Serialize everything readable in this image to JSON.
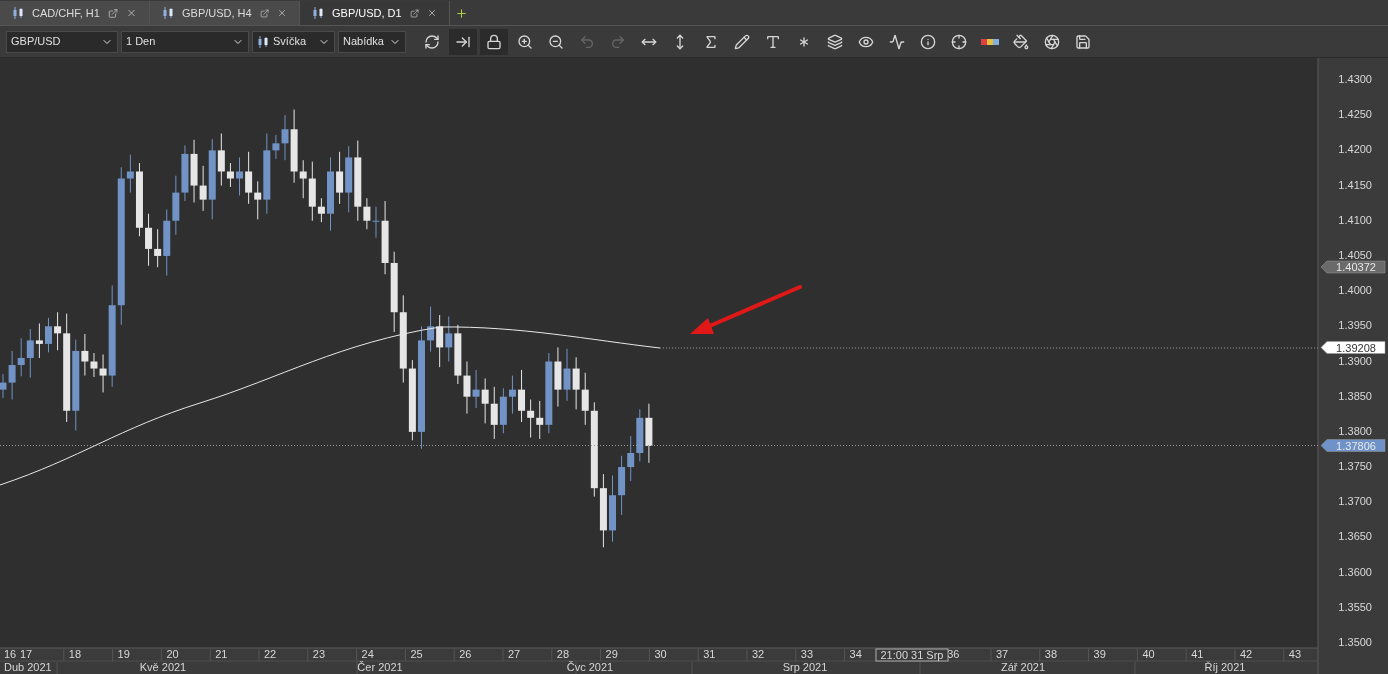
{
  "tabs": [
    {
      "label": "CAD/CHF, H1",
      "selected": false
    },
    {
      "label": "GBP/USD, H4",
      "selected": false
    },
    {
      "label": "GBP/USD, D1",
      "selected": true
    }
  ],
  "toolbar": {
    "dropdowns": [
      {
        "value": "GBP/USD"
      },
      {
        "value": "1 Den"
      },
      {
        "value": "Svíčka",
        "kind": "candle"
      },
      {
        "value": "Nabídka"
      }
    ],
    "icon_buttons": [
      {
        "kind": "refresh",
        "pressed": false,
        "disabled": false
      },
      {
        "kind": "shift",
        "pressed": true,
        "disabled": false
      },
      {
        "kind": "lock",
        "pressed": true,
        "disabled": false
      },
      {
        "kind": "zoom-in",
        "pressed": false,
        "disabled": false
      },
      {
        "kind": "zoom-out",
        "pressed": false,
        "disabled": false
      },
      {
        "kind": "undo",
        "pressed": false,
        "disabled": true
      },
      {
        "kind": "redo",
        "pressed": false,
        "disabled": true
      },
      {
        "kind": "horizontal",
        "pressed": false,
        "disabled": false
      },
      {
        "kind": "vertical",
        "pressed": false,
        "disabled": false
      },
      {
        "kind": "function",
        "pressed": false,
        "disabled": false
      },
      {
        "kind": "pencil",
        "pressed": false,
        "disabled": false
      },
      {
        "kind": "text",
        "pressed": false,
        "disabled": false
      },
      {
        "kind": "nodes",
        "pressed": false,
        "disabled": false
      },
      {
        "kind": "layers",
        "pressed": false,
        "disabled": false
      },
      {
        "kind": "eye",
        "pressed": false,
        "disabled": false
      },
      {
        "kind": "wave",
        "pressed": false,
        "disabled": false
      },
      {
        "kind": "info",
        "pressed": false,
        "disabled": false
      },
      {
        "kind": "crosshair",
        "pressed": false,
        "disabled": false
      },
      {
        "kind": "colors",
        "pressed": false,
        "disabled": false
      },
      {
        "kind": "bucket",
        "pressed": false,
        "disabled": false
      },
      {
        "kind": "aperture",
        "pressed": false,
        "disabled": false
      },
      {
        "kind": "save",
        "pressed": false,
        "disabled": false
      }
    ]
  },
  "price_axis": {
    "labels": [
      "1.4300",
      "1.4250",
      "1.4200",
      "1.4150",
      "1.4100",
      "1.4050",
      "1.4000",
      "1.3950",
      "1.3900",
      "1.3850",
      "1.3800",
      "1.3750",
      "1.3700",
      "1.3650",
      "1.3600",
      "1.3550",
      "1.3500"
    ],
    "tags": [
      {
        "label": "1.40372",
        "color": "#6a6a6a"
      },
      {
        "label": "1.39208",
        "color": "#ffffff"
      },
      {
        "label": "1.37806",
        "color": "#6f93c8"
      }
    ]
  },
  "time_axis": {
    "weeks": [
      "16",
      "17",
      "18",
      "19",
      "20",
      "21",
      "22",
      "23",
      "24",
      "25",
      "26",
      "27",
      "28",
      "29",
      "30",
      "31",
      "32",
      "33",
      "34",
      "36",
      "37",
      "38",
      "39",
      "40",
      "41",
      "42",
      "43"
    ],
    "crosshair_label": "21:00 31 Srp",
    "months": [
      "Dub 2021",
      "Kvě 2021",
      "Čer 2021",
      "Čvc 2021",
      "Srp 2021",
      "Zář 2021",
      "Říj 2021"
    ]
  }
}
